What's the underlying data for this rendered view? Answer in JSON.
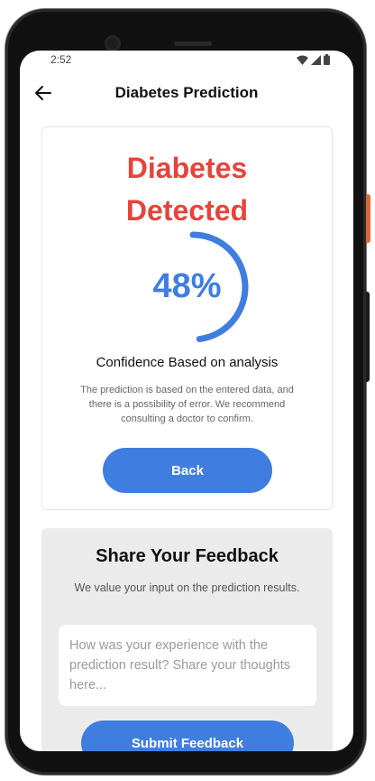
{
  "status_bar": {
    "time": "2:52"
  },
  "app_bar": {
    "title": "Diabetes Prediction"
  },
  "result": {
    "title_line1": "Diabetes",
    "title_line2": "Detected",
    "confidence_percent": 48,
    "confidence_display": "48%",
    "confidence_label": "Confidence Based on analysis",
    "disclaimer": "The prediction is based on the entered data, and there is a possibility of error. We recommend consulting a doctor to confirm.",
    "back_label": "Back"
  },
  "feedback": {
    "title": "Share Your Feedback",
    "subtitle": "We value your input on the prediction results.",
    "placeholder": "How was your experience with the prediction result? Share your thoughts here...",
    "submit_label": "Submit Feedback"
  },
  "colors": {
    "danger": "#e6443a",
    "accent": "#3f7ee0"
  },
  "icons": {
    "back": "arrow-left-icon",
    "wifi": "wifi-icon",
    "signal": "signal-icon",
    "battery": "battery-icon"
  }
}
